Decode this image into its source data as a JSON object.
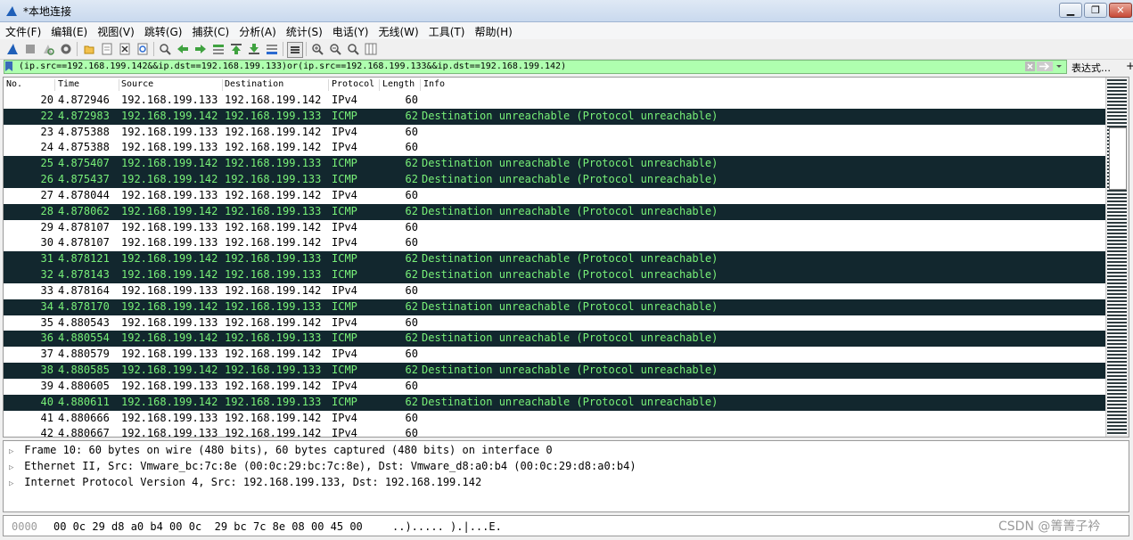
{
  "window": {
    "title": "*本地连接",
    "min": "▁",
    "max": "❐",
    "close": "✕"
  },
  "menu": [
    "文件(F)",
    "编辑(E)",
    "视图(V)",
    "跳转(G)",
    "捕获(C)",
    "分析(A)",
    "统计(S)",
    "电话(Y)",
    "无线(W)",
    "工具(T)",
    "帮助(H)"
  ],
  "filter": {
    "value": "(ip.src==192.168.199.142&&ip.dst==192.168.199.133)or(ip.src==192.168.199.133&&ip.dst==192.168.199.142)",
    "expression_label": "表达式…",
    "plus": "+"
  },
  "columns": [
    "No.",
    "Time",
    "Source",
    "Destination",
    "Protocol",
    "Length",
    "Info"
  ],
  "packets": [
    {
      "no": "20",
      "time": "4.872946",
      "src": "192.168.199.133",
      "dst": "192.168.199.142",
      "proto": "IPv4",
      "len": "60",
      "info": ""
    },
    {
      "no": "22",
      "time": "4.872983",
      "src": "192.168.199.142",
      "dst": "192.168.199.133",
      "proto": "ICMP",
      "len": "62",
      "info": "Destination unreachable (Protocol unreachable)"
    },
    {
      "no": "23",
      "time": "4.875388",
      "src": "192.168.199.133",
      "dst": "192.168.199.142",
      "proto": "IPv4",
      "len": "60",
      "info": ""
    },
    {
      "no": "24",
      "time": "4.875388",
      "src": "192.168.199.133",
      "dst": "192.168.199.142",
      "proto": "IPv4",
      "len": "60",
      "info": ""
    },
    {
      "no": "25",
      "time": "4.875407",
      "src": "192.168.199.142",
      "dst": "192.168.199.133",
      "proto": "ICMP",
      "len": "62",
      "info": "Destination unreachable (Protocol unreachable)"
    },
    {
      "no": "26",
      "time": "4.875437",
      "src": "192.168.199.142",
      "dst": "192.168.199.133",
      "proto": "ICMP",
      "len": "62",
      "info": "Destination unreachable (Protocol unreachable)"
    },
    {
      "no": "27",
      "time": "4.878044",
      "src": "192.168.199.133",
      "dst": "192.168.199.142",
      "proto": "IPv4",
      "len": "60",
      "info": ""
    },
    {
      "no": "28",
      "time": "4.878062",
      "src": "192.168.199.142",
      "dst": "192.168.199.133",
      "proto": "ICMP",
      "len": "62",
      "info": "Destination unreachable (Protocol unreachable)"
    },
    {
      "no": "29",
      "time": "4.878107",
      "src": "192.168.199.133",
      "dst": "192.168.199.142",
      "proto": "IPv4",
      "len": "60",
      "info": ""
    },
    {
      "no": "30",
      "time": "4.878107",
      "src": "192.168.199.133",
      "dst": "192.168.199.142",
      "proto": "IPv4",
      "len": "60",
      "info": ""
    },
    {
      "no": "31",
      "time": "4.878121",
      "src": "192.168.199.142",
      "dst": "192.168.199.133",
      "proto": "ICMP",
      "len": "62",
      "info": "Destination unreachable (Protocol unreachable)"
    },
    {
      "no": "32",
      "time": "4.878143",
      "src": "192.168.199.142",
      "dst": "192.168.199.133",
      "proto": "ICMP",
      "len": "62",
      "info": "Destination unreachable (Protocol unreachable)"
    },
    {
      "no": "33",
      "time": "4.878164",
      "src": "192.168.199.133",
      "dst": "192.168.199.142",
      "proto": "IPv4",
      "len": "60",
      "info": ""
    },
    {
      "no": "34",
      "time": "4.878170",
      "src": "192.168.199.142",
      "dst": "192.168.199.133",
      "proto": "ICMP",
      "len": "62",
      "info": "Destination unreachable (Protocol unreachable)"
    },
    {
      "no": "35",
      "time": "4.880543",
      "src": "192.168.199.133",
      "dst": "192.168.199.142",
      "proto": "IPv4",
      "len": "60",
      "info": ""
    },
    {
      "no": "36",
      "time": "4.880554",
      "src": "192.168.199.142",
      "dst": "192.168.199.133",
      "proto": "ICMP",
      "len": "62",
      "info": "Destination unreachable (Protocol unreachable)"
    },
    {
      "no": "37",
      "time": "4.880579",
      "src": "192.168.199.133",
      "dst": "192.168.199.142",
      "proto": "IPv4",
      "len": "60",
      "info": ""
    },
    {
      "no": "38",
      "time": "4.880585",
      "src": "192.168.199.142",
      "dst": "192.168.199.133",
      "proto": "ICMP",
      "len": "62",
      "info": "Destination unreachable (Protocol unreachable)"
    },
    {
      "no": "39",
      "time": "4.880605",
      "src": "192.168.199.133",
      "dst": "192.168.199.142",
      "proto": "IPv4",
      "len": "60",
      "info": ""
    },
    {
      "no": "40",
      "time": "4.880611",
      "src": "192.168.199.142",
      "dst": "192.168.199.133",
      "proto": "ICMP",
      "len": "62",
      "info": "Destination unreachable (Protocol unreachable)"
    },
    {
      "no": "41",
      "time": "4.880666",
      "src": "192.168.199.133",
      "dst": "192.168.199.142",
      "proto": "IPv4",
      "len": "60",
      "info": ""
    },
    {
      "no": "42",
      "time": "4.880667",
      "src": "192.168.199.133",
      "dst": "192.168.199.142",
      "proto": "IPv4",
      "len": "60",
      "info": ""
    }
  ],
  "details": [
    "Frame 10: 60 bytes on wire (480 bits), 60 bytes captured (480 bits) on interface 0",
    "Ethernet II, Src: Vmware_bc:7c:8e (00:0c:29:bc:7c:8e), Dst: Vmware_d8:a0:b4 (00:0c:29:d8:a0:b4)",
    "Internet Protocol Version 4, Src: 192.168.199.133, Dst: 192.168.199.142"
  ],
  "bytes": {
    "offset": "0000",
    "hex": "00 0c 29 d8 a0 b4 00 0c  29 bc 7c 8e 08 00 45 00",
    "ascii": "..)..... ).|...E."
  },
  "watermark": "CSDN @箐箐子衿",
  "colors": {
    "icmp_bg": "#12272e",
    "icmp_fg": "#78f078",
    "filter_ok": "#afffaf"
  }
}
